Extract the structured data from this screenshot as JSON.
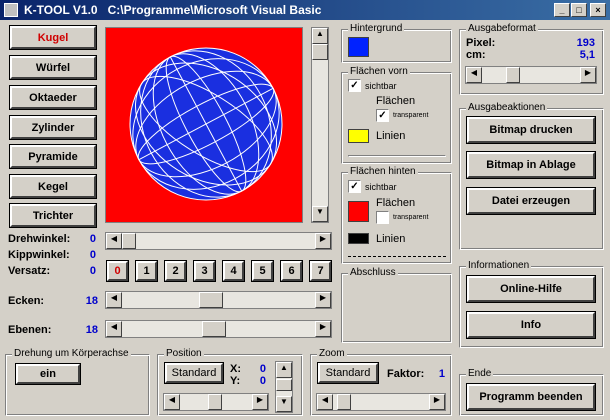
{
  "titlebar": {
    "title": "K-TOOL V1.0   C:\\Programme\\Microsoft Visual Basic",
    "min": "_",
    "max": "□",
    "close": "×"
  },
  "shapes": [
    "Kugel",
    "Würfel",
    "Oktaeder",
    "Zylinder",
    "Pyramide",
    "Kegel",
    "Trichter"
  ],
  "preview": {
    "background": "#ff0000",
    "sphere_fill": "#1a2fe0",
    "wire_color": "#ffffff"
  },
  "controls": {
    "drehwinkel_label": "Drehwinkel:",
    "drehwinkel_value": "0",
    "kippwinkel_label": "Kippwinkel:",
    "kippwinkel_value": "0",
    "versatz_label": "Versatz:",
    "versatz_value": "0",
    "versatz_buttons": [
      "0",
      "1",
      "2",
      "3",
      "4",
      "5",
      "6",
      "7"
    ],
    "ecken_label": "Ecken:",
    "ecken_value": "18",
    "ebenen_label": "Ebenen:",
    "ebenen_value": "18"
  },
  "drehung": {
    "title": "Drehung um Körperachse",
    "button": "ein"
  },
  "position": {
    "title": "Position",
    "button": "Standard",
    "x_label": "X:",
    "x_value": "0",
    "y_label": "Y:",
    "y_value": "0"
  },
  "zoom": {
    "title": "Zoom",
    "button": "Standard",
    "faktor_label": "Faktor:",
    "faktor_value": "1"
  },
  "hintergrund": {
    "title": "Hintergrund",
    "color": "#0022ff"
  },
  "flaechen_vorn": {
    "title": "Flächen vorn",
    "sichtbar": "sichtbar",
    "flaechen": "Flächen",
    "transparent": "transparent",
    "linien": "Linien",
    "fill_color": "#ffff00"
  },
  "flaechen_hinten": {
    "title": "Flächen hinten",
    "sichtbar": "sichtbar",
    "flaechen": "Flächen",
    "transparent": "transparent",
    "linien": "Linien",
    "fill_color": "#ff0000",
    "line_color": "#000000"
  },
  "abschluss": {
    "title": "Abschluss"
  },
  "ausgabeformat": {
    "title": "Ausgabeformat",
    "pixel_label": "Pixel:",
    "pixel_value": "193",
    "cm_label": "cm:",
    "cm_value": "5,1"
  },
  "ausgabeaktionen": {
    "title": "Ausgabeaktionen",
    "buttons": [
      "Bitmap drucken",
      "Bitmap in Ablage",
      "Datei erzeugen"
    ]
  },
  "informationen": {
    "title": "Informationen",
    "buttons": [
      "Online-Hilfe",
      "Info"
    ]
  },
  "ende": {
    "title": "Ende",
    "button": "Programm beenden"
  }
}
